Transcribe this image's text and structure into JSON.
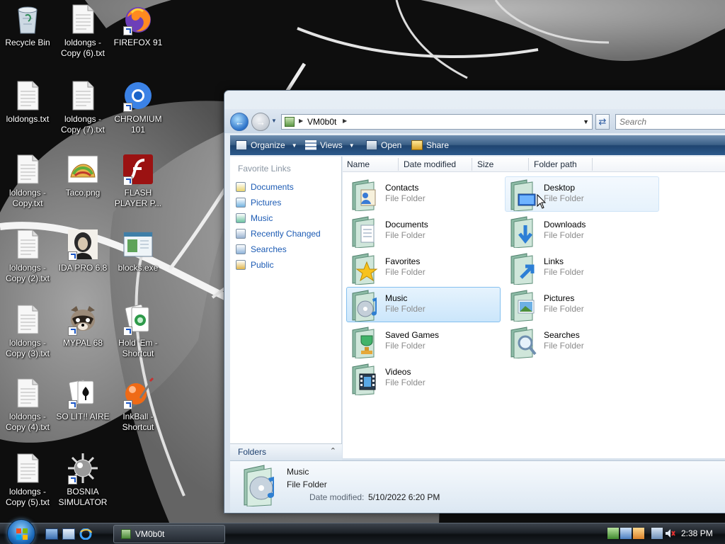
{
  "desktop": {
    "icons": [
      {
        "label": "Recycle Bin",
        "icon": "recycle-bin-icon"
      },
      {
        "label": "loldongs - Copy (6).txt",
        "icon": "text-file-icon"
      },
      {
        "label": "FIREFOX 91",
        "icon": "firefox-icon"
      },
      {
        "label": "loldongs.txt",
        "icon": "text-file-icon"
      },
      {
        "label": "loldongs - Copy (7).txt",
        "icon": "text-file-icon"
      },
      {
        "label": "CHROMIUM 101",
        "icon": "chromium-icon"
      },
      {
        "label": "loldongs - Copy.txt",
        "icon": "text-file-icon"
      },
      {
        "label": "Taco.png",
        "icon": "taco-image-icon"
      },
      {
        "label": "FLASH PLAYER P...",
        "icon": "flash-player-icon"
      },
      {
        "label": "loldongs - Copy (2).txt",
        "icon": "text-file-icon"
      },
      {
        "label": "IDA PRO 6.8",
        "icon": "ida-pro-icon"
      },
      {
        "label": "blocks.exe",
        "icon": "exe-window-icon"
      },
      {
        "label": "loldongs - Copy (3).txt",
        "icon": "text-file-icon"
      },
      {
        "label": "MYPAL 68",
        "icon": "raccoon-icon"
      },
      {
        "label": "Hold 'Em - Shortcut",
        "icon": "poker-cards-icon"
      },
      {
        "label": "loldongs - Copy (4).txt",
        "icon": "text-file-icon"
      },
      {
        "label": "SO LIT!! AIRE",
        "icon": "solitaire-icon"
      },
      {
        "label": "InkBall - Shortcut",
        "icon": "inkball-icon"
      },
      {
        "label": "loldongs - Copy (5).txt",
        "icon": "text-file-icon"
      },
      {
        "label": "BOSNIA SIMULATOR",
        "icon": "spiky-mine-icon"
      }
    ]
  },
  "explorer": {
    "address": {
      "crumb": "VM0b0t"
    },
    "search": {
      "placeholder": "Search"
    },
    "toolbar": {
      "organize": "Organize",
      "views": "Views",
      "open": "Open",
      "share": "Share"
    },
    "nav": {
      "heading": "Favorite Links",
      "items": [
        "Documents",
        "Pictures",
        "Music",
        "Recently Changed",
        "Searches",
        "Public"
      ],
      "folders_label": "Folders"
    },
    "columns": [
      "Name",
      "Date modified",
      "Size",
      "Folder path"
    ],
    "items": [
      {
        "name": "Contacts",
        "type": "File Folder",
        "icon": "contacts-folder-icon"
      },
      {
        "name": "Desktop",
        "type": "File Folder",
        "icon": "desktop-folder-icon"
      },
      {
        "name": "Documents",
        "type": "File Folder",
        "icon": "documents-folder-icon"
      },
      {
        "name": "Downloads",
        "type": "File Folder",
        "icon": "downloads-folder-icon"
      },
      {
        "name": "Favorites",
        "type": "File Folder",
        "icon": "favorites-folder-icon"
      },
      {
        "name": "Links",
        "type": "File Folder",
        "icon": "links-folder-icon"
      },
      {
        "name": "Music",
        "type": "File Folder",
        "icon": "music-folder-icon"
      },
      {
        "name": "Pictures",
        "type": "File Folder",
        "icon": "pictures-folder-icon"
      },
      {
        "name": "Saved Games",
        "type": "File Folder",
        "icon": "saved-games-folder-icon"
      },
      {
        "name": "Searches",
        "type": "File Folder",
        "icon": "searches-folder-icon"
      },
      {
        "name": "Videos",
        "type": "File Folder",
        "icon": "videos-folder-icon"
      }
    ],
    "details": {
      "name": "Music",
      "type": "File Folder",
      "date_label": "Date modified:",
      "date_value": "5/10/2022 6:20 PM"
    }
  },
  "taskbar": {
    "task_label": "VM0b0t",
    "clock": "2:38 PM"
  },
  "colors": {
    "selection": "#cbe6fb",
    "toolbar": "#2d5a8b",
    "link": "#1c5bb4"
  }
}
